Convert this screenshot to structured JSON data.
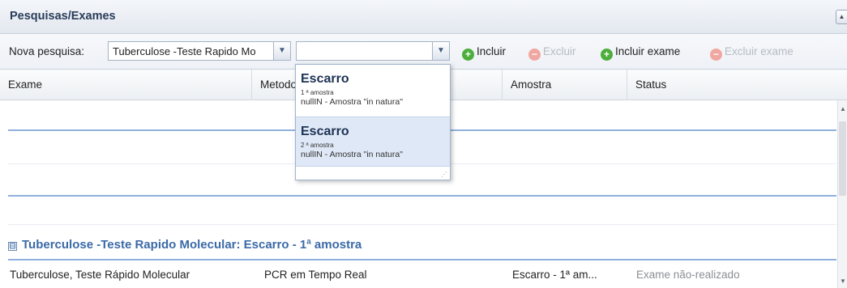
{
  "panel": {
    "title": "Pesquisas/Exames",
    "collapse_glyph": "▲"
  },
  "toolbar": {
    "label": "Nova pesquisa:",
    "pesquisa_value": "Tuberculose -Teste Rapido Molecular",
    "amostra_value": "",
    "arrow_glyph": "▼",
    "buttons": {
      "incluir": {
        "label": "Incluir",
        "icon": "plus-icon",
        "color": "#4cae3b"
      },
      "excluir": {
        "label": "Excluir",
        "icon": "minus-icon",
        "color": "#f1a7a1"
      },
      "incluir_exame": {
        "label": "Incluir exame",
        "icon": "plus-icon",
        "color": "#4cae3b"
      },
      "excluir_exame": {
        "label": "Excluir exame",
        "icon": "minus-icon",
        "color": "#f1a7a1"
      }
    }
  },
  "grid": {
    "columns": [
      "Exame",
      "Metodologia",
      "Amostra",
      "Status"
    ],
    "group": {
      "toggle": "⊟",
      "title": "Tuberculose -Teste Rapido Molecular: Escarro - 1ª amostra"
    },
    "rows": [
      {
        "exame": "Tuberculose, Teste Rápido Molecular",
        "metodologia": "PCR em Tempo Real",
        "amostra": "Escarro - 1ª am...",
        "status": "Exame não-realizado"
      }
    ]
  },
  "dropdown": {
    "items": [
      {
        "title": "Escarro",
        "sub": "1 ª amostra",
        "desc": "nullIN - Amostra \"in natura\""
      },
      {
        "title": "Escarro",
        "sub": "2 ª amostra",
        "desc": "nullIN - Amostra \"in natura\""
      }
    ],
    "resize_glyph": "⋰"
  },
  "colors": {
    "accent": "#3b6aa7",
    "selection": "#dfe8f6",
    "separator": "#8fb0de"
  }
}
